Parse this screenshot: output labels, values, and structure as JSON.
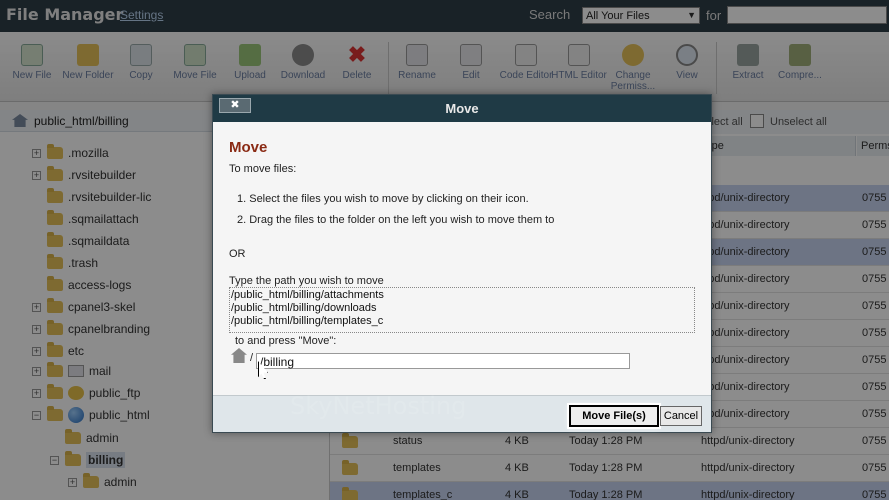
{
  "header": {
    "app_title": "File Manager",
    "settings_label": "Settings",
    "search_label": "Search",
    "search_scope": "All Your Files",
    "for_label": "for"
  },
  "toolbar": [
    {
      "label": "New File",
      "icon": "new-file-icon"
    },
    {
      "label": "New Folder",
      "icon": "new-folder-icon"
    },
    {
      "label": "Copy",
      "icon": "copy-icon"
    },
    {
      "label": "Move File",
      "icon": "move-file-icon"
    },
    {
      "label": "Upload",
      "icon": "upload-icon"
    },
    {
      "label": "Download",
      "icon": "download-icon"
    },
    {
      "label": "Delete",
      "icon": "delete-icon"
    },
    {
      "label": "Rename",
      "icon": "rename-icon"
    },
    {
      "label": "Edit",
      "icon": "edit-icon"
    },
    {
      "label": "Code Editor",
      "icon": "code-editor-icon"
    },
    {
      "label": "HTML Editor",
      "icon": "html-editor-icon"
    },
    {
      "label": "Change Permiss...",
      "icon": "key-icon"
    },
    {
      "label": "View",
      "icon": "view-icon"
    },
    {
      "label": "Extract",
      "icon": "extract-icon"
    },
    {
      "label": "Compre...",
      "icon": "compress-icon"
    }
  ],
  "tree": {
    "path": "public_html/billing",
    "items": [
      {
        "label": ".mozilla"
      },
      {
        "label": ".rvsitebuilder"
      },
      {
        "label": ".rvsitebuilder-lic"
      },
      {
        "label": ".sqmailattach"
      },
      {
        "label": ".sqmaildata"
      },
      {
        "label": ".trash"
      },
      {
        "label": "access-logs"
      },
      {
        "label": "cpanel3-skel"
      },
      {
        "label": "cpanelbranding"
      },
      {
        "label": "etc"
      },
      {
        "label": "mail"
      },
      {
        "label": "public_ftp"
      },
      {
        "label": "public_html"
      },
      {
        "label": "admin"
      },
      {
        "label": "billing"
      },
      {
        "label": "admin"
      }
    ]
  },
  "files": {
    "select_all": "Select all",
    "unselect_all": "Unselect all",
    "col_type": "Type",
    "col_perms": "Perms",
    "rows": [
      {
        "name": "",
        "size": "",
        "date": "",
        "type": "httpd/unix-directory",
        "perms": "0755"
      },
      {
        "name": "",
        "size": "",
        "date": "",
        "type": "httpd/unix-directory",
        "perms": "0755"
      },
      {
        "name": "",
        "size": "",
        "date": "",
        "type": "httpd/unix-directory",
        "perms": "0755"
      },
      {
        "name": "",
        "size": "",
        "date": "",
        "type": "httpd/unix-directory",
        "perms": "0755"
      },
      {
        "name": "",
        "size": "",
        "date": "",
        "type": "httpd/unix-directory",
        "perms": "0755"
      },
      {
        "name": "",
        "size": "",
        "date": "",
        "type": "httpd/unix-directory",
        "perms": "0755"
      },
      {
        "name": "",
        "size": "",
        "date": "",
        "type": "httpd/unix-directory",
        "perms": "0755"
      },
      {
        "name": "",
        "size": "",
        "date": "",
        "type": "httpd/unix-directory",
        "perms": "0755"
      },
      {
        "name": "",
        "size": "",
        "date": "",
        "type": "httpd/unix-directory",
        "perms": "0755"
      },
      {
        "name": "status",
        "size": "4 KB",
        "date": "Today 1:28 PM",
        "type": "httpd/unix-directory",
        "perms": "0755"
      },
      {
        "name": "templates",
        "size": "4 KB",
        "date": "Today 1:28 PM",
        "type": "httpd/unix-directory",
        "perms": "0755"
      },
      {
        "name": "templates_c",
        "size": "4 KB",
        "date": "Today 1:28 PM",
        "type": "httpd/unix-directory",
        "perms": "0755"
      }
    ]
  },
  "dialog": {
    "title": "Move",
    "close_label": "✖",
    "heading": "Move",
    "intro": "To move files:",
    "step1": "1.  Select the files you wish to move by clicking on their icon.",
    "step2": "2.  Drag the files to the folder on the left you wish to move them to",
    "or_label": "OR",
    "path_prompt": "Type the path you wish to move",
    "paths": [
      "/public_html/billing/attachments",
      "/public_html/billing/downloads",
      "/public_html/billing/templates_c"
    ],
    "press_move": "to and press \"Move\":",
    "dest_prefix": "/",
    "dest_value": "/billing",
    "move_button": "Move File(s)",
    "cancel_button": "Cancel"
  },
  "watermark": "SkyNetHosting"
}
